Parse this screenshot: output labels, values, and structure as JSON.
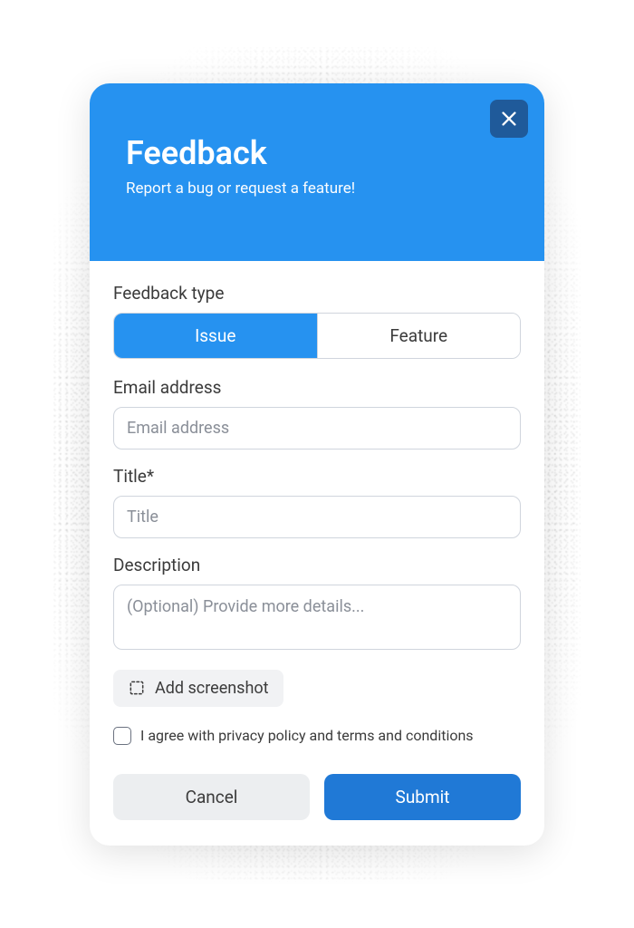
{
  "header": {
    "title": "Feedback",
    "subtitle": "Report a bug or request a feature!"
  },
  "form": {
    "feedback_type": {
      "label": "Feedback type",
      "options": {
        "issue": "Issue",
        "feature": "Feature"
      },
      "selected": "issue"
    },
    "email": {
      "label": "Email address",
      "placeholder": "Email address",
      "value": ""
    },
    "title_field": {
      "label": "Title*",
      "placeholder": "Title",
      "value": ""
    },
    "description": {
      "label": "Description",
      "placeholder": "(Optional) Provide more details...",
      "value": ""
    },
    "screenshot_button": "Add screenshot",
    "agree": {
      "label": "I agree with privacy policy and terms and conditions",
      "checked": false
    }
  },
  "footer": {
    "cancel": "Cancel",
    "submit": "Submit"
  },
  "colors": {
    "primary": "#2692f0",
    "submit": "#2079d6",
    "close_bg": "#1f5a9a"
  }
}
